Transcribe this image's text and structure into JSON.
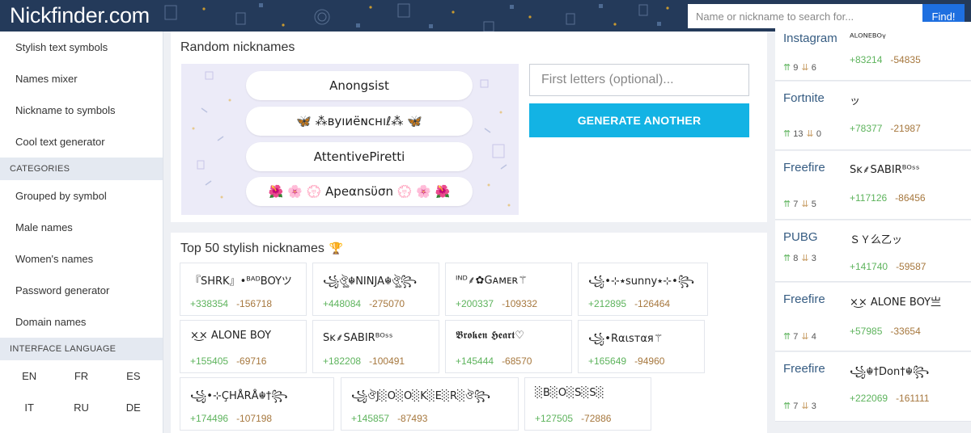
{
  "header": {
    "logo": "Nickfinder.com",
    "search_placeholder": "Name or nickname to search for...",
    "find_label": "Find!"
  },
  "sidebar": {
    "links": [
      "Stylish text symbols",
      "Names mixer",
      "Nickname to symbols",
      "Cool text generator"
    ],
    "categories_heading": "CATEGORIES",
    "categories": [
      "Grouped by symbol",
      "Male names",
      "Women's names",
      "Password generator",
      "Domain names"
    ],
    "language_heading": "INTERFACE LANGUAGE",
    "languages": [
      "EN",
      "FR",
      "ES",
      "IT",
      "RU",
      "DE"
    ]
  },
  "random": {
    "title": "Random nicknames",
    "nicknames": [
      "Anongsist",
      "🦋 ⁂ʙуıиёɴcнıℓ⁂ 🦋",
      "AttentivePiretti",
      "🌺 🌸 💮 Apeαnsϋσn 💮 🌸 🌺"
    ],
    "first_letters_placeholder": "First letters (optional)...",
    "generate_label": "GENERATE ANOTHER"
  },
  "top": {
    "title": "Top 50 stylish nicknames",
    "trophy_icon": "trophy-icon",
    "cards": [
      {
        "nick": "『SHRK』•ᴮᴬᴰBOYツ",
        "pos": "+338354",
        "neg": "-156718"
      },
      {
        "nick": "꧁ঔৣ☬NINJA☬ঔৣ꧂",
        "pos": "+448084",
        "neg": "-275070"
      },
      {
        "nick": "ᴵᴺᴰ⸙✿Gᴀᴍᴇʀ⚚",
        "pos": "+200337",
        "neg": "-109332"
      },
      {
        "nick": "꧁•⊹٭sunny٭⊹•꧂",
        "pos": "+212895",
        "neg": "-126464"
      },
      {
        "nick": "×͜×  ALONE  BOY",
        "pos": "+155405",
        "neg": "-69716"
      },
      {
        "nick": "Sĸ⸙SABIRᴮᴼˢˢ",
        "pos": "+182208",
        "neg": "-100491"
      },
      {
        "nick": "𝕭𝖗𝖔𝖐𝖊𝖓 𝕳𝖊𝖆𝖗𝖙♡",
        "pos": "+145444",
        "neg": "-68570"
      },
      {
        "nick": "꧁•Rαιѕтαя⚚",
        "pos": "+165649",
        "neg": "-94960"
      },
      {
        "nick": "꧁•⊹ÇHÅRÅ☬†꧂",
        "pos": "+174496",
        "neg": "-107198"
      },
      {
        "nick": "꧁ঔJ░O░O░K░E░R░ঔ꧂",
        "pos": "+145857",
        "neg": "-87493"
      },
      {
        "nick": "░B░O░S░S░",
        "pos": "+127505",
        "neg": "-72886"
      }
    ]
  },
  "right": {
    "cards": [
      {
        "game": "Instagram",
        "nick": "ᴬᴸᴼᴺᴱᴮᴼᵞ",
        "up": "9",
        "down": "6",
        "pos": "+83214",
        "neg": "-54835"
      },
      {
        "game": "Fortnite",
        "nick": "ッ",
        "up": "13",
        "down": "0",
        "pos": "+78377",
        "neg": "-21987"
      },
      {
        "game": "Freefire",
        "nick": "Sĸ⸙SABIRᴮᴼˢˢ",
        "up": "7",
        "down": "5",
        "pos": "+117126",
        "neg": "-86456"
      },
      {
        "game": "PUBG",
        "nick": "ＳＹ么乙ッ",
        "up": "8",
        "down": "3",
        "pos": "+141740",
        "neg": "-59587"
      },
      {
        "game": "Freefire",
        "nick": "×͜×  ALONE  BOY亗",
        "up": "7",
        "down": "4",
        "pos": "+57985",
        "neg": "-33654"
      },
      {
        "game": "Freefire",
        "nick": "꧁☬†Don†☬꧂",
        "up": "7",
        "down": "3",
        "pos": "+222069",
        "neg": "-161111"
      }
    ]
  }
}
